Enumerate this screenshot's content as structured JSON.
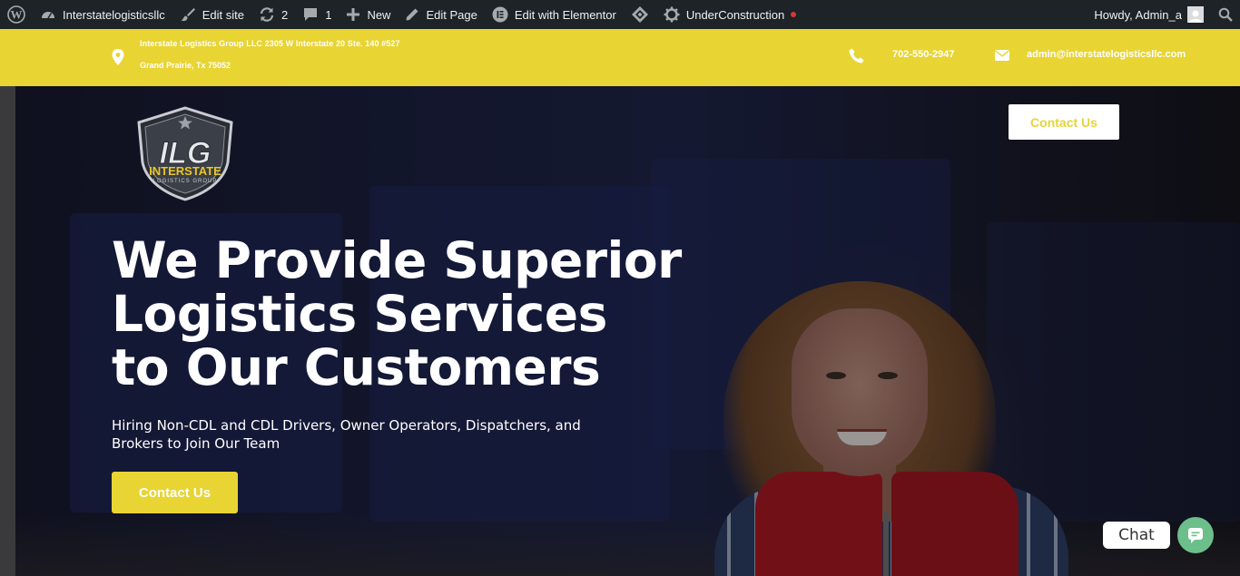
{
  "admin_bar": {
    "site_name": "Interstatelogisticsllc",
    "edit_site": "Edit site",
    "updates_count": "2",
    "comments_count": "1",
    "new_label": "New",
    "edit_page": "Edit Page",
    "edit_elementor": "Edit with Elementor",
    "under_construction": "UnderConstruction",
    "howdy": "Howdy, Admin_a"
  },
  "topbar": {
    "address_line1": "Interstate Logistics Group LLC 2305 W Interstate 20 Ste. 140 #527",
    "address_line2": "Grand Prairie, Tx 75052",
    "phone": "702-550-2947",
    "email": "admin@interstatelogisticsllc.com"
  },
  "logo": {
    "letters": "ILG",
    "name": "INTERSTATE",
    "tagline": "LOGISTICS GROUP"
  },
  "header": {
    "contact_button": "Contact Us"
  },
  "hero": {
    "title_line1": "We Provide Superior",
    "title_line2": "Logistics Services",
    "title_line3": "to Our Customers",
    "subtitle_line1": "Hiring Non-CDL and CDL Drivers, Owner Operators, Dispatchers, and",
    "subtitle_line2": "Brokers to Join Our Team",
    "cta_button": "Contact Us"
  },
  "chat": {
    "label": "Chat"
  },
  "colors": {
    "brand_yellow": "#e8d433",
    "admin_bar": "#1d2327",
    "chat_green": "#6cbf8a",
    "notice_red": "#d63638"
  }
}
